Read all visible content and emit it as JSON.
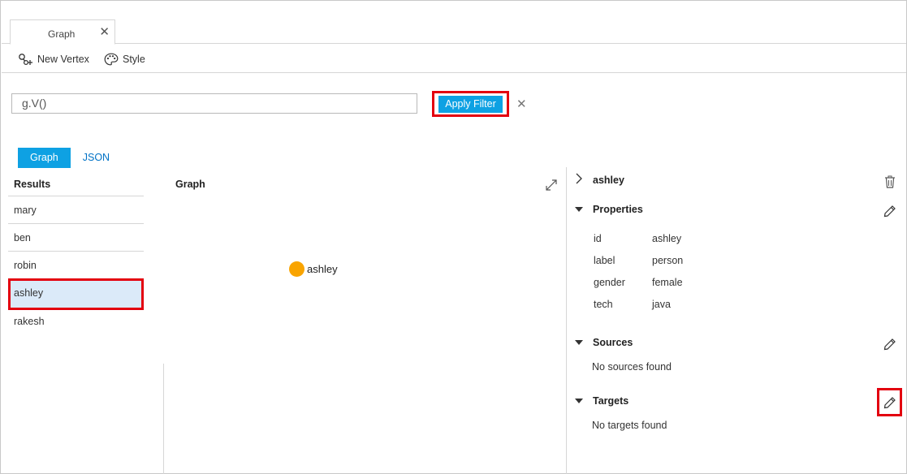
{
  "tabs": [
    {
      "label": "Graph",
      "close": "✕"
    }
  ],
  "toolbar": {
    "new_vertex": "New Vertex",
    "style": "Style"
  },
  "query": {
    "value": "g.V()",
    "apply_label": "Apply Filter",
    "clear": "✕"
  },
  "view_tabs": [
    {
      "label": "Graph",
      "active": true
    },
    {
      "label": "JSON",
      "active": false
    }
  ],
  "results": {
    "heading": "Results",
    "items": [
      "mary",
      "ben",
      "robin",
      "ashley",
      "rakesh"
    ],
    "selected": "ashley"
  },
  "graph": {
    "heading": "Graph",
    "node_label": "ashley",
    "node_color": "#f9a400"
  },
  "details": {
    "title": "ashley",
    "properties_label": "Properties",
    "properties": [
      {
        "key": "id",
        "value": "ashley"
      },
      {
        "key": "label",
        "value": "person"
      },
      {
        "key": "gender",
        "value": "female"
      },
      {
        "key": "tech",
        "value": "java"
      }
    ],
    "sources_label": "Sources",
    "sources_empty": "No sources found",
    "targets_label": "Targets",
    "targets_empty": "No targets found"
  },
  "colors": {
    "accent": "#0ea1e3",
    "highlight": "#e3000f",
    "selection": "#dbeaf9",
    "link": "#0072c6"
  },
  "icons": [
    "close-icon",
    "new-vertex-icon",
    "palette-icon",
    "expand-icon",
    "chevron-right-icon",
    "trash-icon",
    "caret-down-icon",
    "pencil-icon"
  ]
}
